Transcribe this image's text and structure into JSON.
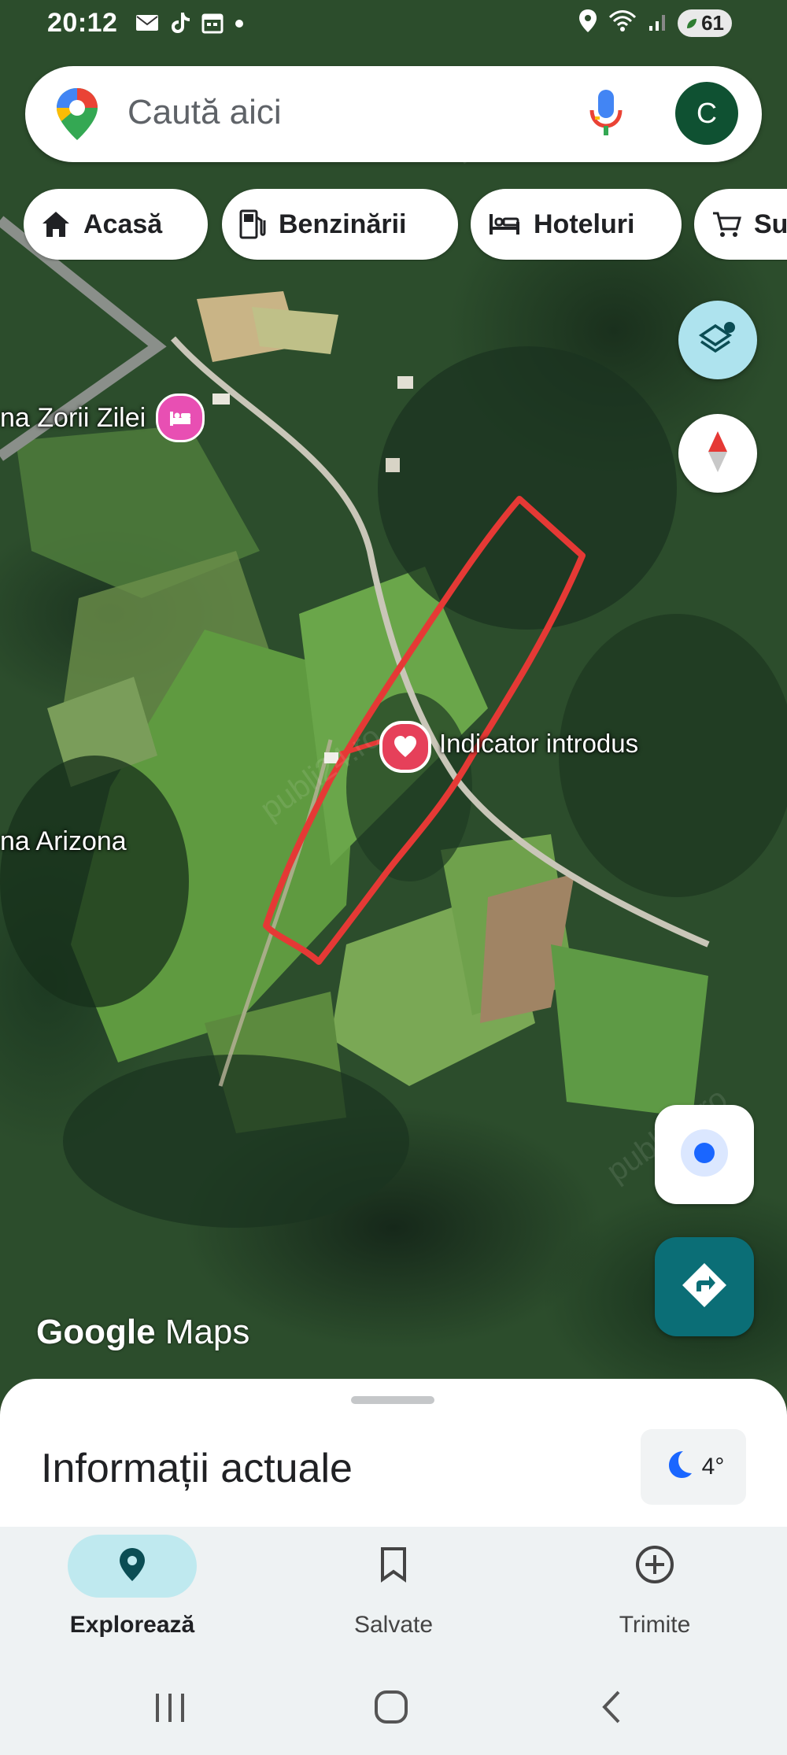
{
  "status_bar": {
    "time": "20:12",
    "battery_level": "61",
    "icons_left": [
      "mail-icon",
      "tiktok-icon",
      "calendar-icon",
      "dot-icon"
    ],
    "icons_right": [
      "location-icon",
      "wifi-icon",
      "signal-icon",
      "battery-icon"
    ]
  },
  "search": {
    "placeholder": "Caută aici",
    "avatar_initial": "C"
  },
  "chips": [
    {
      "label": "Acasă",
      "icon": "home-icon"
    },
    {
      "label": "Benzinării",
      "icon": "gas-station-icon"
    },
    {
      "label": "Hoteluri",
      "icon": "bed-icon"
    },
    {
      "label": "Su",
      "icon": "cart-icon"
    }
  ],
  "map": {
    "labels": {
      "hotel": "na Zorii Zilei",
      "place": "na Arizona",
      "marker": "Indicator introdus"
    },
    "logo": {
      "google": "Google",
      "maps": "Maps"
    },
    "watermark": "publi24.ro",
    "colors": {
      "outline": "#e53935",
      "marker": "#e6405a",
      "hotel_pin": "#e84fb3"
    }
  },
  "bottom_sheet": {
    "title": "Informații actuale",
    "weather": {
      "temperature": "4°",
      "icon": "moon-icon"
    }
  },
  "bottom_nav": {
    "items": [
      {
        "label": "Explorează",
        "icon": "location-pin-icon",
        "active": true
      },
      {
        "label": "Salvate",
        "icon": "bookmark-icon",
        "active": false
      },
      {
        "label": "Trimite",
        "icon": "add-circle-icon",
        "active": false
      }
    ]
  },
  "system_nav": [
    "recents-icon",
    "home-button-icon",
    "back-icon"
  ],
  "colors": {
    "accent": "#0b6e76",
    "active_nav": "#bfe9ef"
  }
}
